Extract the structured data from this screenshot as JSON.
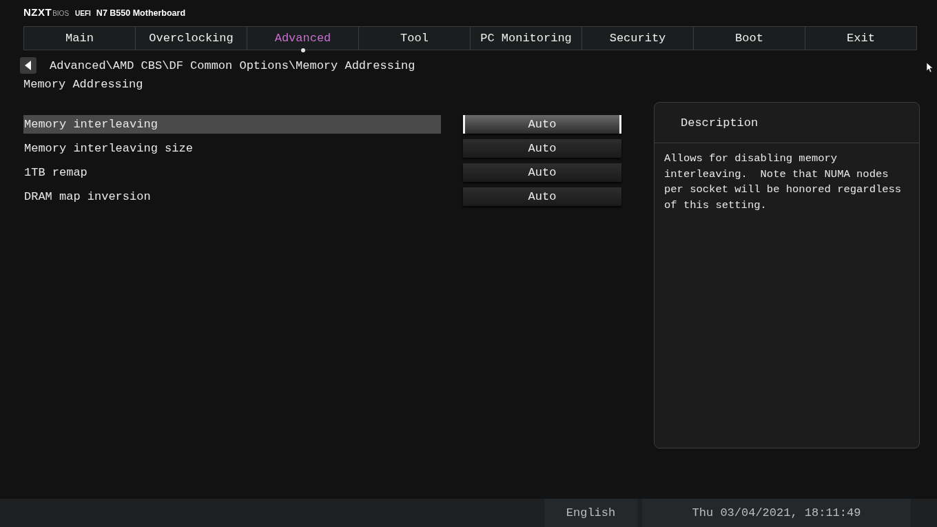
{
  "header": {
    "brand": "NZXT",
    "bios": "BIOS",
    "uefi": "UEFI",
    "model": "N7 B550 Motherboard"
  },
  "tabs": [
    {
      "label": "Main",
      "selected": false
    },
    {
      "label": "Overclocking",
      "selected": false
    },
    {
      "label": "Advanced",
      "selected": true
    },
    {
      "label": "Tool",
      "selected": false
    },
    {
      "label": "PC Monitoring",
      "selected": false
    },
    {
      "label": "Security",
      "selected": false
    },
    {
      "label": "Boot",
      "selected": false
    },
    {
      "label": "Exit",
      "selected": false
    }
  ],
  "breadcrumb": "Advanced\\AMD CBS\\DF Common Options\\Memory Addressing",
  "page_title": "Memory Addressing",
  "settings": [
    {
      "label": "Memory interleaving",
      "value": "Auto",
      "selected": true
    },
    {
      "label": "Memory interleaving size",
      "value": "Auto",
      "selected": false
    },
    {
      "label": "1TB remap",
      "value": "Auto",
      "selected": false
    },
    {
      "label": "DRAM map inversion",
      "value": "Auto",
      "selected": false
    }
  ],
  "description": {
    "title": "Description",
    "text": "Allows for disabling memory interleaving.  Note that NUMA nodes per socket will be honored regardless of this setting."
  },
  "status_bar": {
    "language": "English",
    "datetime": "Thu 03/04/2021, 18:11:49"
  }
}
